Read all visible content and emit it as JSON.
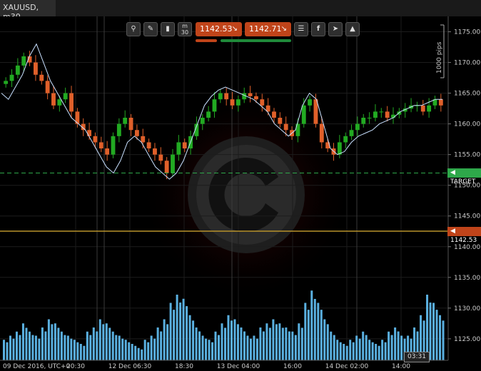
{
  "window": {
    "tab_title": "XAUUSD, m30"
  },
  "toolbar": {
    "icons": [
      "zoom-icon",
      "chart-settings-icon",
      "chart-type-icon",
      "timeframe-icon",
      "indicators-icon",
      "facebook-icon",
      "share-icon",
      "drawing-icon"
    ],
    "timeframe_label": "m\n30",
    "sell_price": "1142.53",
    "buy_price": "1142.71",
    "sell_arrow": "↘",
    "buy_arrow": "↘"
  },
  "pips_label": "1000 pips",
  "target_label": "TARGET",
  "current_price_label": "1142.53",
  "crosshair_time": "03:31",
  "colors": {
    "up": "#22aa22",
    "down": "#e0602a",
    "sma": "#c8e0ff",
    "volume": "#5ab0e0",
    "target": "#2ea84a",
    "price_line": "#b8922a",
    "accent": "#c0441a"
  },
  "chart_data": {
    "type": "candlestick",
    "yaxis": {
      "ticks": [
        1125.0,
        1130.0,
        1135.0,
        1140.0,
        1145.0,
        1150.0,
        1155.0,
        1160.0,
        1165.0,
        1170.0,
        1175.0
      ],
      "range": [
        1121.5,
        1177.5
      ]
    },
    "xaxis": {
      "tick_labels": [
        "09 Dec 2016, UTC+0",
        "20:30",
        "12 Dec 06:30",
        "18:30",
        "13 Dec 04:00",
        "16:00",
        "14 Dec 02:00",
        "14:00"
      ]
    },
    "close_approx": [
      1167,
      1168,
      1169.5,
      1171,
      1170,
      1168,
      1167,
      1165,
      1163,
      1164,
      1165,
      1162,
      1160,
      1159,
      1158,
      1157,
      1156,
      1155,
      1158,
      1160,
      1161,
      1159,
      1158,
      1157,
      1156,
      1155,
      1154,
      1152,
      1155,
      1157,
      1156,
      1158,
      1160,
      1161,
      1162,
      1164,
      1165,
      1164,
      1163,
      1164,
      1165,
      1164.5,
      1164,
      1163,
      1162,
      1161,
      1160,
      1159,
      1158,
      1160,
      1163,
      1164,
      1160,
      1157,
      1156,
      1155,
      1157,
      1158,
      1159,
      1160,
      1161,
      1161,
      1162,
      1162,
      1161,
      1161.5,
      1162,
      1162.5,
      1163,
      1163,
      1162,
      1163,
      1164,
      1163
    ],
    "sma_approx": [
      1165,
      1164,
      1166,
      1168,
      1171,
      1173,
      1170,
      1167,
      1165,
      1163,
      1161,
      1160,
      1159,
      1157,
      1155,
      1153,
      1152,
      1154,
      1157,
      1158,
      1157,
      1155,
      1153,
      1152,
      1151,
      1152,
      1154,
      1157,
      1160,
      1163,
      1164.5,
      1165.5,
      1166,
      1165.5,
      1165,
      1164.5,
      1164,
      1163,
      1162,
      1160,
      1159,
      1158,
      1159,
      1163,
      1165,
      1164,
      1160,
      1156,
      1155,
      1155.5,
      1157,
      1158,
      1158.5,
      1159,
      1160,
      1160.5,
      1161,
      1162,
      1162.5,
      1163,
      1163,
      1163.5,
      1164,
      1164
    ],
    "volume_approx": [
      0.25,
      0.3,
      0.35,
      0.45,
      0.35,
      0.3,
      0.4,
      0.5,
      0.45,
      0.35,
      0.3,
      0.25,
      0.2,
      0.35,
      0.4,
      0.5,
      0.45,
      0.35,
      0.3,
      0.25,
      0.2,
      0.15,
      0.25,
      0.3,
      0.4,
      0.5,
      0.7,
      0.8,
      0.75,
      0.55,
      0.4,
      0.3,
      0.25,
      0.35,
      0.45,
      0.55,
      0.5,
      0.4,
      0.3,
      0.3,
      0.4,
      0.45,
      0.5,
      0.45,
      0.4,
      0.35,
      0.45,
      0.7,
      0.85,
      0.7,
      0.5,
      0.35,
      0.25,
      0.2,
      0.25,
      0.3,
      0.35,
      0.25,
      0.2,
      0.25,
      0.35,
      0.4,
      0.3,
      0.3,
      0.4,
      0.55,
      0.8,
      0.7,
      0.55
    ],
    "target_price": 1152.0,
    "current_price": 1142.53
  }
}
